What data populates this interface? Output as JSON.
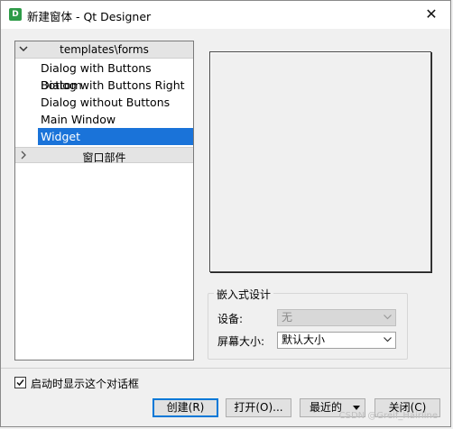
{
  "window": {
    "title": "新建窗体 - Qt Designer",
    "app_icon": "D",
    "close_glyph": "✕"
  },
  "templates": {
    "group_label": "templates\\forms",
    "items": [
      "Dialog with Buttons Bottom",
      "Dialog with Buttons Right",
      "Dialog without Buttons",
      "Main Window",
      "Widget"
    ],
    "selected_index": 4,
    "collapsed_group_label": "窗口部件"
  },
  "embedded": {
    "group_title": "嵌入式设计",
    "device_label": "设备:",
    "device_value": "无",
    "screen_label": "屏幕大小:",
    "screen_value": "默认大小"
  },
  "startup_checkbox": {
    "label": "启动时显示这个对话框",
    "checked": true
  },
  "buttons": {
    "create": "创建(R)",
    "open": "打开(O)...",
    "recent": "最近的",
    "close": "关闭(C)"
  },
  "watermark": "CSDN @Greif_Hairline",
  "colors": {
    "selection": "#1a73d9",
    "app_icon": "#2e9b48",
    "default_button_border": "#0078d7"
  }
}
